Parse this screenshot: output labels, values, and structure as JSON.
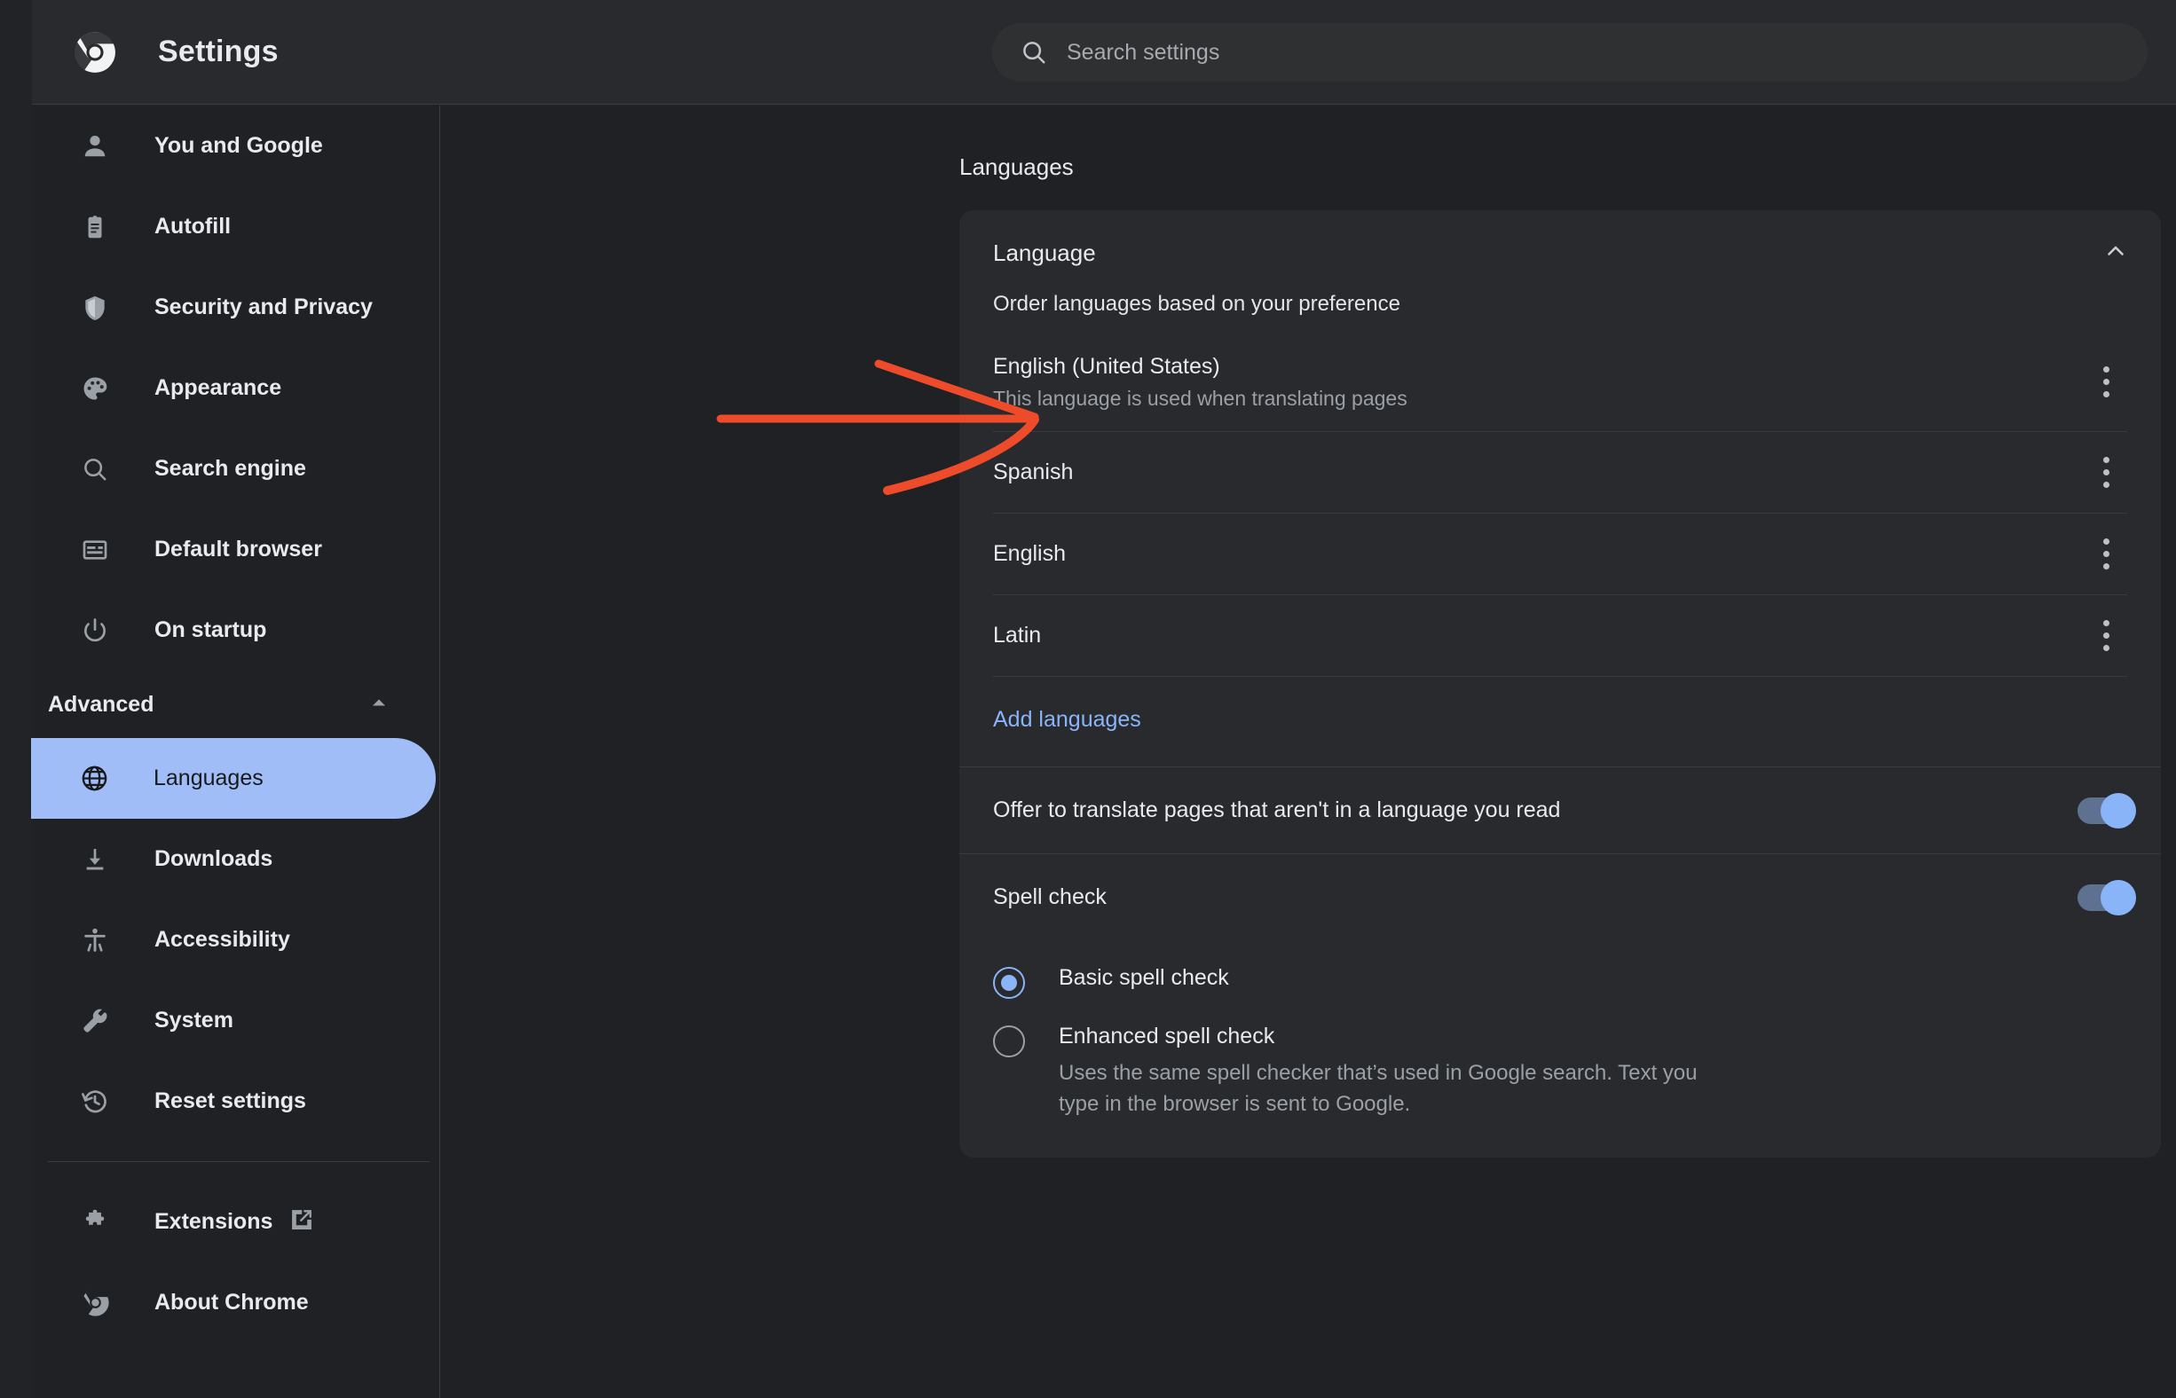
{
  "header": {
    "title": "Settings",
    "logo_icon": "chrome-logo-icon",
    "search": {
      "icon": "search-icon",
      "placeholder": "Search settings",
      "value": ""
    }
  },
  "sidebar": {
    "items": [
      {
        "label": "You and Google",
        "icon": "person-icon"
      },
      {
        "label": "Autofill",
        "icon": "clipboard-icon"
      },
      {
        "label": "Security and Privacy",
        "icon": "shield-icon"
      },
      {
        "label": "Appearance",
        "icon": "palette-icon"
      },
      {
        "label": "Search engine",
        "icon": "search-icon"
      },
      {
        "label": "Default browser",
        "icon": "browser-window-icon"
      },
      {
        "label": "On startup",
        "icon": "power-icon"
      }
    ],
    "advanced": {
      "label": "Advanced",
      "caret_icon": "caret-up-icon",
      "expanded": true,
      "items": [
        {
          "label": "Languages",
          "icon": "globe-icon",
          "selected": true
        },
        {
          "label": "Downloads",
          "icon": "download-icon",
          "selected": false
        },
        {
          "label": "Accessibility",
          "icon": "accessibility-icon",
          "selected": false
        },
        {
          "label": "System",
          "icon": "wrench-icon",
          "selected": false
        },
        {
          "label": "Reset settings",
          "icon": "history-restore-icon",
          "selected": false
        }
      ]
    },
    "footer_items": [
      {
        "label": "Extensions",
        "icon": "puzzle-icon",
        "trailing_icon": "external-link-icon"
      },
      {
        "label": "About Chrome",
        "icon": "chrome-logo-icon",
        "trailing_icon": ""
      }
    ]
  },
  "main": {
    "page_title": "Languages",
    "card": {
      "heading": "Language",
      "collapse_icon": "chevron-up-icon",
      "subtitle": "Order languages based on your preference",
      "languages": [
        {
          "name": "English (United States)",
          "sub": "This language is used when translating pages",
          "menu_icon": "more-vert-icon"
        },
        {
          "name": "Spanish",
          "sub": "",
          "menu_icon": "more-vert-icon"
        },
        {
          "name": "English",
          "sub": "",
          "menu_icon": "more-vert-icon"
        },
        {
          "name": "Latin",
          "sub": "",
          "menu_icon": "more-vert-icon"
        }
      ],
      "add_languages_label": "Add languages",
      "translate_row": {
        "label": "Offer to translate pages that aren't in a language you read",
        "toggle_on": true
      }
    },
    "spell_check": {
      "label": "Spell check",
      "toggle_on": true,
      "options": [
        {
          "label": "Basic spell check",
          "desc": "",
          "selected": true
        },
        {
          "label": "Enhanced spell check",
          "desc": "Uses the same spell checker that’s used in Google search. Text you type in the browser is sent to Google.",
          "selected": false
        }
      ]
    }
  },
  "annotation": {
    "shape": "arrow",
    "color": "#EE4B2B",
    "points_to": "English (United States)"
  },
  "colors": {
    "page_bg": "#202124",
    "card_bg": "#292A2D",
    "accent_blue": "#8AB4F8",
    "selected_pill": "#A0BDF8",
    "text_primary": "#E8EAED",
    "text_secondary": "#9AA0A6",
    "annotation": "#EE4B2B"
  }
}
